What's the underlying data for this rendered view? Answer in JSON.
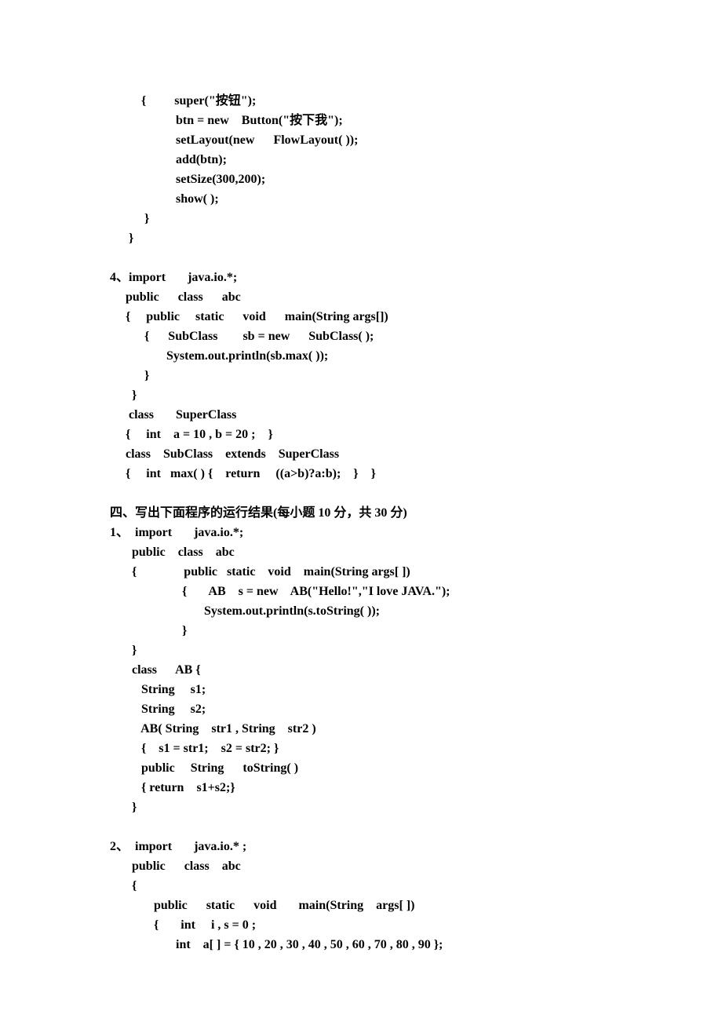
{
  "lines": [
    {
      "text": "          {         super(\"按钮\");",
      "bold": true
    },
    {
      "text": "                     btn = new    Button(\"按下我\");",
      "bold": true
    },
    {
      "text": "                     setLayout(new      FlowLayout( ));",
      "bold": true
    },
    {
      "text": "                     add(btn);",
      "bold": true
    },
    {
      "text": "                     setSize(300,200);",
      "bold": true
    },
    {
      "text": "                     show( );",
      "bold": true
    },
    {
      "text": "           }",
      "bold": true
    },
    {
      "text": "      }",
      "bold": true
    },
    {
      "text": "",
      "bold": false
    },
    {
      "text": "4、import       java.io.*;",
      "bold": true
    },
    {
      "text": "     public      class      abc",
      "bold": true
    },
    {
      "text": "     {     public     static      void      main(String args[])",
      "bold": true
    },
    {
      "text": "           {      SubClass        sb = new      SubClass( );",
      "bold": true
    },
    {
      "text": "                  System.out.println(sb.max( ));",
      "bold": true
    },
    {
      "text": "           }",
      "bold": true
    },
    {
      "text": "       }",
      "bold": true
    },
    {
      "text": "      class       SuperClass",
      "bold": true
    },
    {
      "text": "     {     int    a = 10 , b = 20 ;    }",
      "bold": true
    },
    {
      "text": "     class    SubClass    extends    SuperClass",
      "bold": true
    },
    {
      "text": "     {     int   max( ) {    return     ((a>b)?a:b);    }    }",
      "bold": true
    },
    {
      "text": "",
      "bold": false
    },
    {
      "text": "四、写出下面程序的运行结果(每小题 10 分，共 30 分)",
      "bold": true
    },
    {
      "text": "1、  import       java.io.*;",
      "bold": true
    },
    {
      "text": "       public    class    abc",
      "bold": true
    },
    {
      "text": "       {               public   static    void    main(String args[ ])",
      "bold": true
    },
    {
      "text": "                       {       AB    s = new    AB(\"Hello!\",\"I love JAVA.\");",
      "bold": true
    },
    {
      "text": "                              System.out.println(s.toString( ));",
      "bold": true
    },
    {
      "text": "                       }",
      "bold": true
    },
    {
      "text": "       }",
      "bold": true
    },
    {
      "text": "       class      AB {",
      "bold": true
    },
    {
      "text": "          String     s1;",
      "bold": true
    },
    {
      "text": "          String     s2;",
      "bold": true
    },
    {
      "text": "          AB( String    str1 , String    str2 )",
      "bold": true
    },
    {
      "text": "          {    s1 = str1;    s2 = str2; }",
      "bold": true
    },
    {
      "text": "          public     String      toString( )",
      "bold": true
    },
    {
      "text": "          { return    s1+s2;}",
      "bold": true
    },
    {
      "text": "       }",
      "bold": true
    },
    {
      "text": "",
      "bold": false
    },
    {
      "text": "2、  import       java.io.* ;",
      "bold": true
    },
    {
      "text": "       public      class    abc",
      "bold": true
    },
    {
      "text": "       {",
      "bold": true
    },
    {
      "text": "              public      static      void       main(String    args[ ])",
      "bold": true
    },
    {
      "text": "              {       int     i , s = 0 ;",
      "bold": true
    },
    {
      "text": "                     int    a[ ] = { 10 , 20 , 30 , 40 , 50 , 60 , 70 , 80 , 90 };",
      "bold": true
    }
  ]
}
